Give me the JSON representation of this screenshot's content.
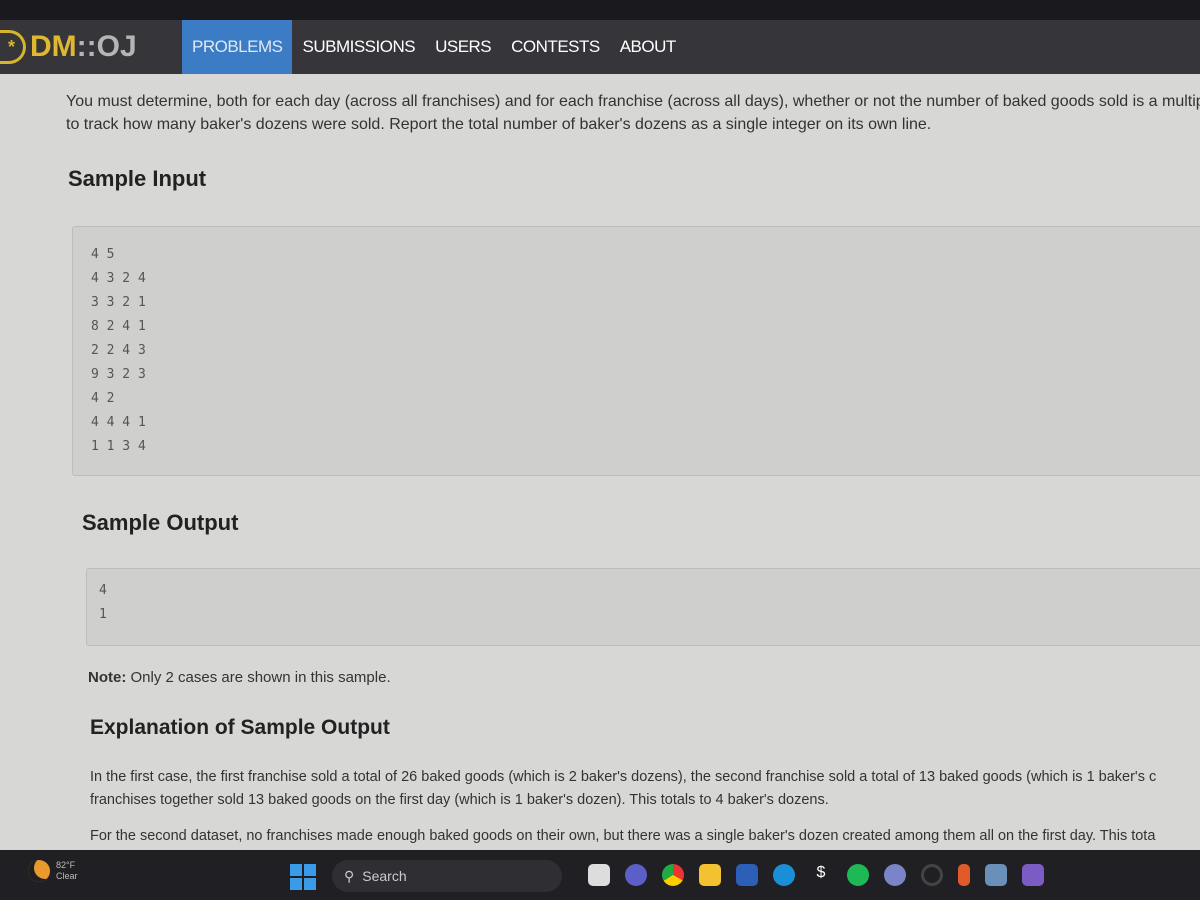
{
  "nav": {
    "logo_dm": "DM",
    "logo_oj": "::OJ",
    "items": [
      "PROBLEMS",
      "SUBMISSIONS",
      "USERS",
      "CONTESTS",
      "ABOUT"
    ],
    "active": "PROBLEMS"
  },
  "intro": [
    "You must determine, both for each day (across all franchises) and for each franchise (across all days), whether or not the number of baked goods sold is a multip",
    "to track how many baker's dozens were sold. Report the total number of baker's dozens as a single integer on its own line."
  ],
  "sample_input": {
    "heading": "Sample Input",
    "lines": [
      "4 5",
      "4 3 2 4",
      "3 3 2 1",
      "8 2 4 1",
      "2 2 4 3",
      "9 3 2 3",
      "4 2",
      "4 4 4 1",
      "1 1 3 4"
    ]
  },
  "sample_output": {
    "heading": "Sample Output",
    "lines": [
      "4",
      "1"
    ]
  },
  "note": {
    "label": "Note:",
    "text": " Only 2 cases are shown in this sample."
  },
  "explanation": {
    "heading": "Explanation of Sample Output",
    "p1": [
      "In the first case, the first franchise sold a total of 26 baked goods (which is 2 baker's dozens), the second franchise sold a total of 13 baked goods (which is 1 baker's c",
      "franchises together sold 13 baked goods on the first day (which is 1 baker's dozen). This totals to 4 baker's dozens."
    ],
    "p2": "For the second dataset, no franchises made enough baked goods on their own, but there was a single baker's dozen created among them all on the first day. This tota"
  },
  "taskbar": {
    "temp": "82°F",
    "condition": "Clear",
    "search_label": "Search",
    "apps": [
      "file-explorer-icon",
      "teams-icon",
      "chrome-icon",
      "folder-icon",
      "word-icon",
      "edge-icon",
      "app-icon",
      "spotify-icon",
      "profile-icon",
      "circle-app-icon",
      "app-orange-icon",
      "mail-icon",
      "visual-studio-icon"
    ]
  }
}
